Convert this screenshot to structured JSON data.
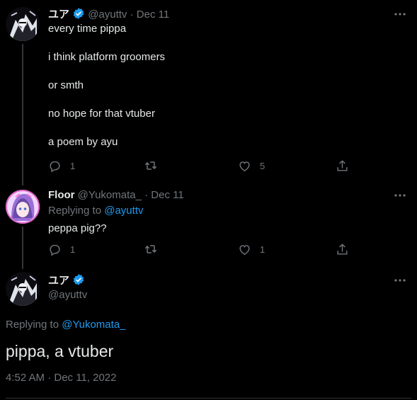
{
  "tweet1": {
    "display_name": "ユア",
    "handle": "@ayuttv",
    "separator": "·",
    "date": "Dec 11",
    "lines": [
      "every time pippa",
      "i think platform groomers",
      "or smth",
      "no hope for that vtuber",
      "a poem by ayu"
    ],
    "reply_count": "1",
    "like_count": "5"
  },
  "tweet2": {
    "display_name": "Floor",
    "handle": "@Yukomata_",
    "separator": "·",
    "date": "Dec 11",
    "replying_prefix": "Replying to",
    "replying_handle": "@ayuttv",
    "text": "peppa pig??",
    "reply_count": "1",
    "like_count": "1"
  },
  "main_tweet": {
    "display_name": "ユア",
    "handle": "@ayuttv",
    "replying_prefix": "Replying to",
    "replying_handle": "@Yukomata_",
    "text": "pippa, a vtuber",
    "timestamp": "4:52 AM · Dec 11, 2022"
  },
  "colors": {
    "background": "#000000",
    "text": "#e7e9ea",
    "muted": "#71767b",
    "accent": "#1d9bf0",
    "thread_line": "#333639"
  },
  "icons": [
    "verified-badge-icon",
    "more-icon",
    "reply-icon",
    "retweet-icon",
    "like-icon",
    "share-icon"
  ]
}
